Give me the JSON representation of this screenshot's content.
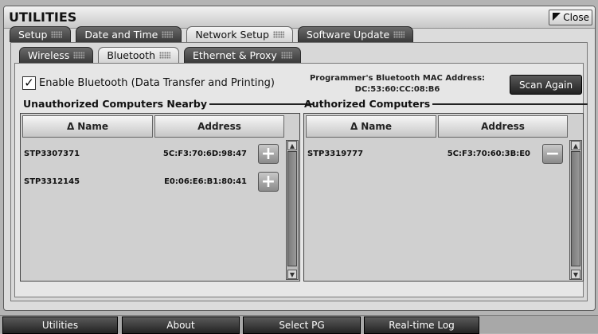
{
  "window": {
    "title": "UTILITIES",
    "close_label": "Close"
  },
  "main_tabs": [
    {
      "label": "Setup",
      "active": false
    },
    {
      "label": "Date and Time",
      "active": false
    },
    {
      "label": "Network Setup",
      "active": true
    },
    {
      "label": "Software Update",
      "active": false
    }
  ],
  "sub_tabs": [
    {
      "label": "Wireless",
      "active": false
    },
    {
      "label": "Bluetooth",
      "active": true
    },
    {
      "label": "Ethernet & Proxy",
      "active": false
    }
  ],
  "bluetooth": {
    "enable_label": "Enable Bluetooth (Data Transfer and Printing)",
    "enable_checked": true,
    "mac_label": "Programmer's Bluetooth MAC Address:",
    "mac_value": "DC:53:60:CC:08:B6",
    "scan_label": "Scan Again"
  },
  "unauthorized": {
    "title": "Unauthorized Computers Nearby",
    "col_name": "Name",
    "col_address": "Address",
    "rows": [
      {
        "name": "STP3307371",
        "address": "5C:F3:70:6D:98:47",
        "action": "+"
      },
      {
        "name": "STP3312145",
        "address": "E0:06:E6:B1:80:41",
        "action": "+"
      }
    ]
  },
  "authorized": {
    "title": "Authorized Computers",
    "col_name": "Name",
    "col_address": "Address",
    "rows": [
      {
        "name": "STP3319777",
        "address": "5C:F3:70:60:3B:E0",
        "action": "−"
      }
    ]
  },
  "sort_glyph": "Δ",
  "bottom_nav": [
    "Utilities",
    "About",
    "Select PG",
    "Real-time Log"
  ]
}
